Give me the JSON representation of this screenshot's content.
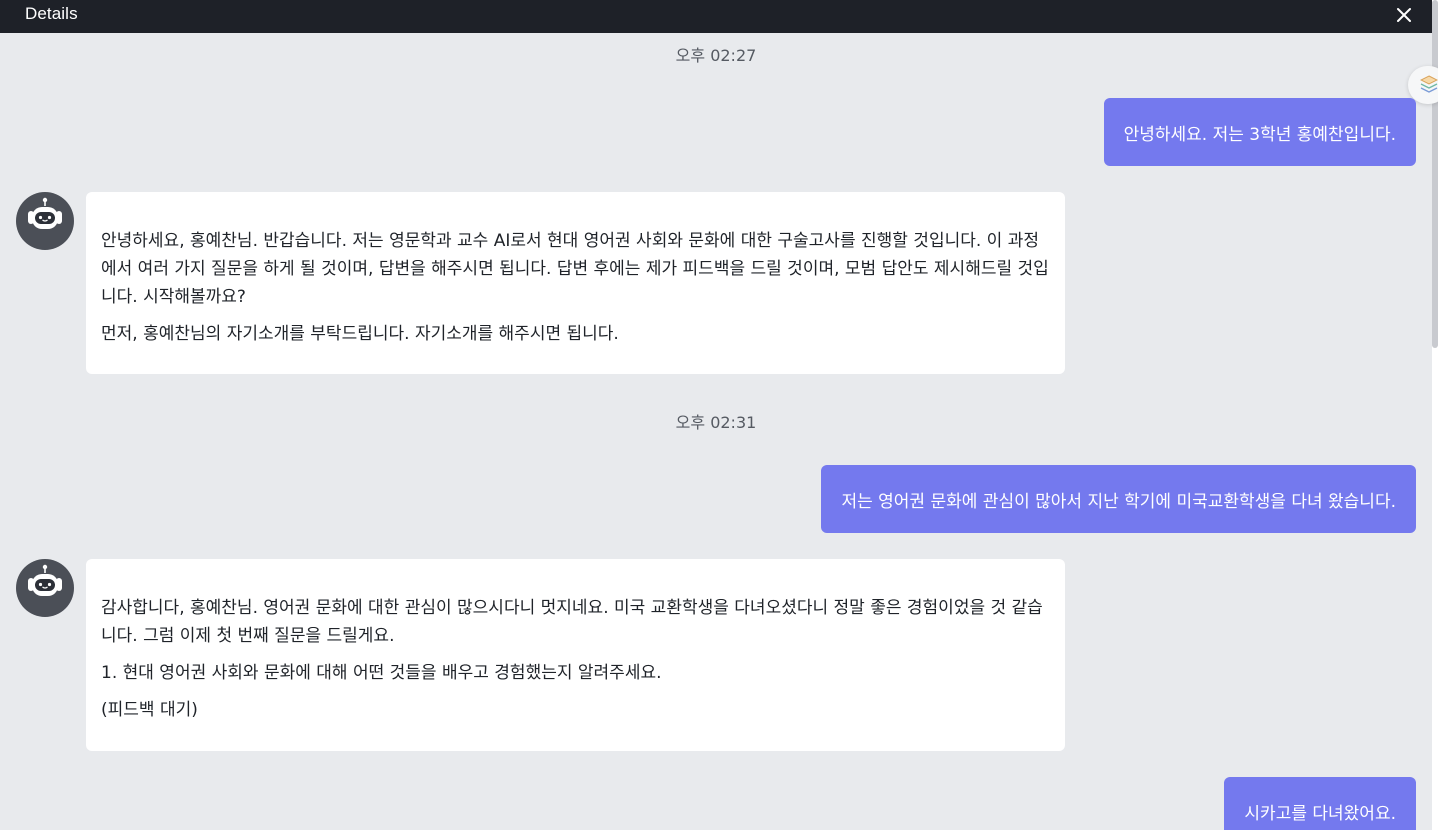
{
  "window": {
    "title": "Details"
  },
  "messages": {
    "ts1": "오후 02:27",
    "user1": "안녕하세요. 저는 3학년 홍예찬입니다.",
    "bot1": {
      "p1": "안녕하세요, 홍예찬님. 반갑습니다. 저는 영문학과 교수 AI로서 현대 영어권 사회와 문화에 대한 구술고사를 진행할 것입니다. 이 과정에서 여러 가지 질문을 하게 될 것이며, 답변을 해주시면 됩니다. 답변 후에는 제가 피드백을 드릴 것이며, 모범 답안도 제시해드릴 것입니다. 시작해볼까요?",
      "p2": "먼저, 홍예찬님의 자기소개를 부탁드립니다. 자기소개를 해주시면 됩니다."
    },
    "ts2": "오후 02:31",
    "user2": "저는 영어권 문화에 관심이 많아서 지난 학기에 미국교환학생을 다녀 왔습니다.",
    "bot2": {
      "p1": "감사합니다, 홍예찬님. 영어권 문화에 대한 관심이 많으시다니 멋지네요. 미국 교환학생을 다녀오셨다니 정말 좋은 경험이었을 것 같습니다. 그럼 이제 첫 번째 질문을 드릴게요.",
      "p2": "1. 현대 영어권 사회와 문화에 대해 어떤 것들을 배우고 경험했는지 알려주세요.",
      "p3": "(피드백 대기)"
    },
    "user3": "시카고를 다녀왔어요."
  },
  "icons": {
    "close": "close-icon",
    "avatar": "robot-avatar-icon",
    "widget": "layers-icon"
  },
  "colors": {
    "user_bubble": "#7479ee",
    "titlebar": "#1e2128",
    "background": "#e8eaed"
  }
}
